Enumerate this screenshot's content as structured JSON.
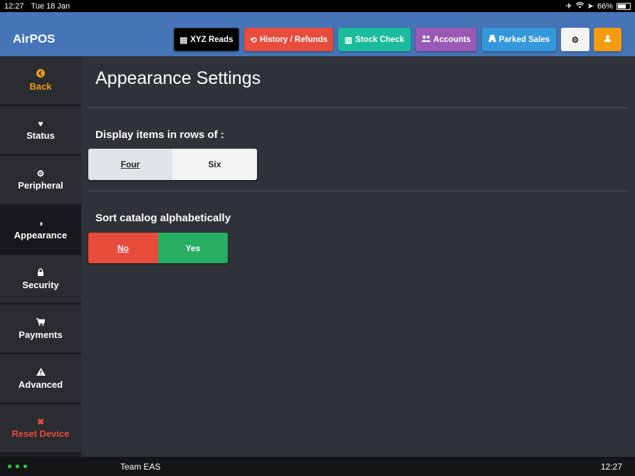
{
  "status_bar": {
    "time": "12:27",
    "date": "Tue 18 Jan",
    "battery": "66%",
    "battery_level": 0.66
  },
  "header": {
    "brand": "AirPOS",
    "buttons": [
      {
        "label": "XYZ Reads",
        "icon": "receipt-icon",
        "color": "#000000"
      },
      {
        "label": "History / Refunds",
        "icon": "history-icon",
        "color": "#e74c3c"
      },
      {
        "label": "Stock Check",
        "icon": "barcode-icon",
        "color": "#1abc9c"
      },
      {
        "label": "Accounts",
        "icon": "users-icon",
        "color": "#9b59b6"
      },
      {
        "label": "Parked Sales",
        "icon": "road-icon",
        "color": "#3498db"
      }
    ],
    "settings_icon": "gear-icon",
    "user_icon": "user-icon",
    "user_color": "#f39c12"
  },
  "sidebar": {
    "items": [
      {
        "label": "Back",
        "icon": "arrow-left-circle-icon",
        "color": "#f39c12"
      },
      {
        "label": "Status",
        "icon": "heartbeat-icon",
        "color": "#ffffff"
      },
      {
        "label": "Peripheral",
        "icon": "gear-icon",
        "color": "#ffffff"
      },
      {
        "label": "Appearance",
        "icon": "contrast-icon",
        "color": "#ffffff",
        "active": true
      },
      {
        "label": "Security",
        "icon": "lock-icon",
        "color": "#ffffff"
      },
      {
        "label": "Payments",
        "icon": "cart-icon",
        "color": "#ffffff"
      },
      {
        "label": "Advanced",
        "icon": "warning-icon",
        "color": "#ffffff"
      },
      {
        "label": "Reset Device",
        "icon": "close-icon",
        "color": "#e74c3c"
      }
    ]
  },
  "main": {
    "title": "Appearance Settings",
    "rows_setting": {
      "label": "Display items in rows of :",
      "options": [
        "Four",
        "Six"
      ],
      "selected": "Four"
    },
    "sort_setting": {
      "label": "Sort catalog alphabetically",
      "options": [
        "No",
        "Yes"
      ],
      "selected": "No",
      "no_color": "#e74c3c",
      "yes_color": "#27ae60"
    }
  },
  "footer": {
    "team": "Team EAS",
    "time": "12:27"
  }
}
